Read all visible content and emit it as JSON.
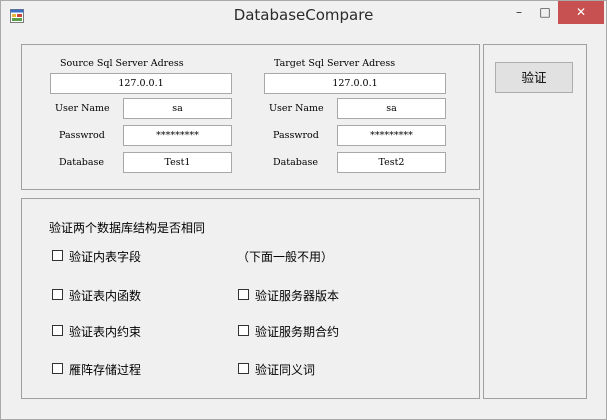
{
  "window": {
    "title": "DatabaseCompare",
    "min_glyph": "–",
    "max_glyph": "□",
    "close_glyph": "✕"
  },
  "source": {
    "heading": "Source Sql Server Adress",
    "address": "127.0.0.1",
    "user_label": "User Name",
    "user": "sa",
    "pass_label": "Passwrod",
    "pass": "*********",
    "db_label": "Database",
    "db": "Test1"
  },
  "target": {
    "heading": "Target Sql Server Adress",
    "address": "127.0.0.1",
    "user_label": "User Name",
    "user": "sa",
    "pass_label": "Passwrod",
    "pass": "*********",
    "db_label": "Database",
    "db": "Test2"
  },
  "checks": {
    "heading": "验证两个数据库结构是否相同",
    "note": "（下面一般不用）",
    "items": [
      {
        "label": "验证内表字段",
        "checked": false
      },
      {
        "label": "验证表内函数",
        "checked": false
      },
      {
        "label": "验证表内约束",
        "checked": false
      },
      {
        "label": "雁阵存储过程",
        "checked": false
      },
      {
        "label": "验证服务器版本",
        "checked": false
      },
      {
        "label": "验证服务期合约",
        "checked": false
      },
      {
        "label": "验证同义词",
        "checked": false
      }
    ]
  },
  "verify_button": "验证"
}
